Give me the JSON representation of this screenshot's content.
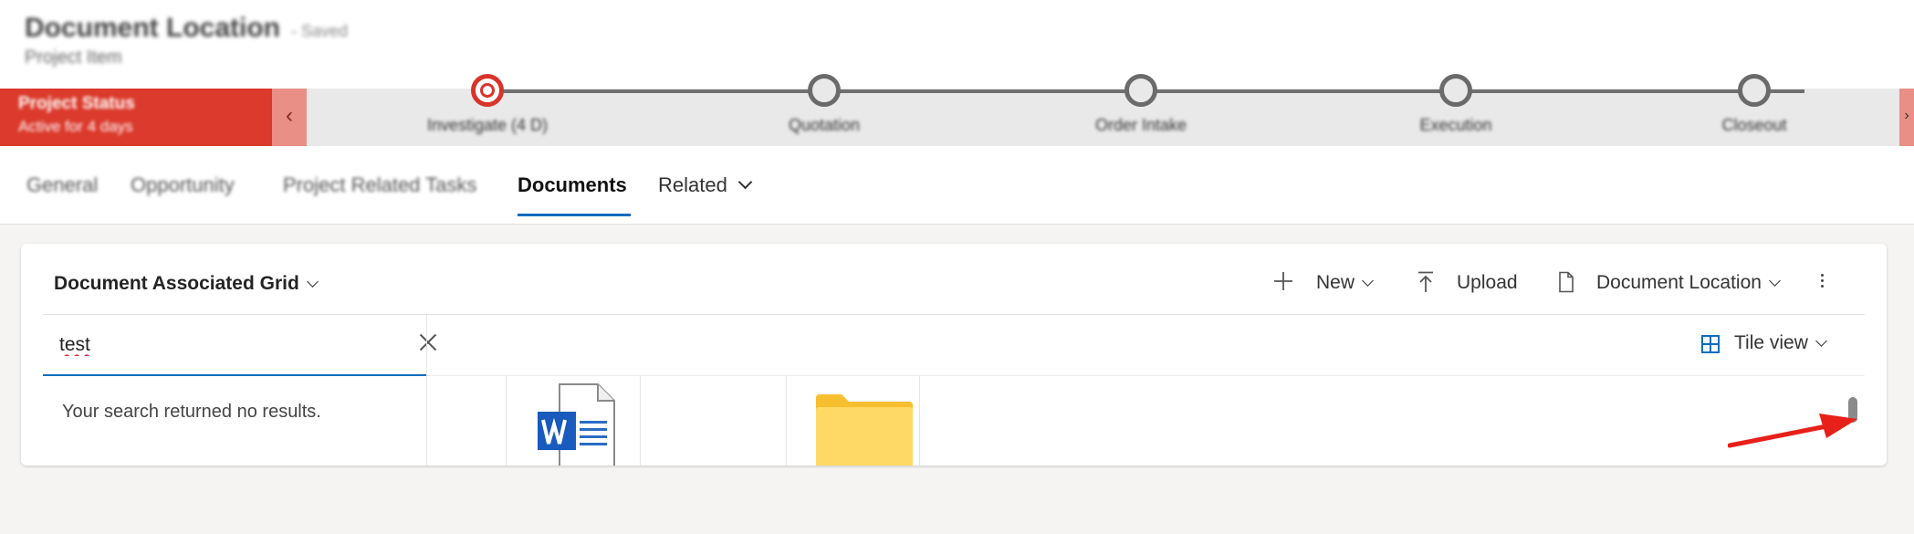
{
  "header": {
    "title": "Document Location",
    "title_suffix": "- Saved",
    "subtitle": "Project Item"
  },
  "bpf": {
    "status_title": "Project Status",
    "status_sub": "Active for 4 days",
    "collapse_glyph": "‹",
    "right_glyph": "›",
    "stages": [
      {
        "label": "Investigate (4 D)"
      },
      {
        "label": "Quotation"
      },
      {
        "label": "Order Intake"
      },
      {
        "label": "Execution"
      },
      {
        "label": "Closeout"
      }
    ]
  },
  "tabs": [
    {
      "label": "General"
    },
    {
      "label": "Opportunity"
    },
    {
      "label": "Project Related Tasks"
    },
    {
      "label": "Documents"
    },
    {
      "label": "Related"
    }
  ],
  "grid": {
    "title": "Document Associated Grid",
    "toolbar": {
      "new_label": "New",
      "upload_label": "Upload",
      "location_label": "Document Location"
    },
    "search": {
      "value": "test"
    },
    "no_results": "Your search returned no results.",
    "view_label": "Tile view"
  },
  "colors": {
    "accent": "#0f6cbd",
    "status_red": "#db3a2c",
    "annotation_arrow": "#e8201a"
  }
}
